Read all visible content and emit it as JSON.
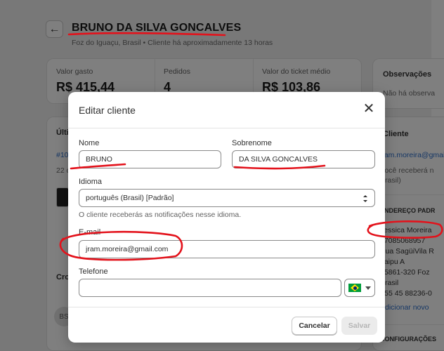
{
  "background": {
    "customer_name": "BRUNO DA SILVA GONCALVES",
    "customer_subtitle": "Foz do Iguaçu, Brasil • Cliente há aproximadamente 13 horas",
    "stats": [
      {
        "label": "Valor gasto",
        "value": "R$ 415,44"
      },
      {
        "label": "Pedidos",
        "value": "4"
      },
      {
        "label": "Valor do ticket médio",
        "value": "R$ 103,86"
      }
    ],
    "observations_title": "Observações",
    "observations_text": "Não há observa",
    "orders_heading": "Últi",
    "order_link": "#10",
    "order_date": "22 d",
    "timeline_heading": "Cro",
    "avatar_initials": "BS",
    "client_heading": "Cliente",
    "client_email": "jram.moreira@gmai",
    "client_email_note_1": "Você receberá n",
    "client_email_note_2": "Brasil)",
    "address_heading": "ENDEREÇO PADR",
    "address_lines": [
      "Jessica Moreira",
      "17085068957",
      "Rua SagüiVila R",
      "Itaipu A",
      "85861-320 Foz",
      "Brasil",
      "+55 45 88236-0"
    ],
    "add_new_link": "Adicionar novo",
    "settings_heading": "CONFIGURAÇÕES"
  },
  "modal": {
    "title": "Editar cliente",
    "first_name": {
      "label": "Nome",
      "value": "BRUNO"
    },
    "last_name": {
      "label": "Sobrenome",
      "value": "DA SILVA GONCALVES"
    },
    "language": {
      "label": "Idioma",
      "value": "português (Brasil) [Padrão]",
      "hint": "O cliente receberás as notificações nesse idioma."
    },
    "email": {
      "label": "E-mail",
      "value": "jram.moreira@gmail.com"
    },
    "phone": {
      "label": "Telefone",
      "value": "",
      "country_icon": "brazil-flag-icon"
    },
    "cancel_label": "Cancelar",
    "save_label": "Salvar"
  },
  "colors": {
    "annotation_red": "#e3121b",
    "overlay": "rgba(0,0,0,0.5)"
  }
}
